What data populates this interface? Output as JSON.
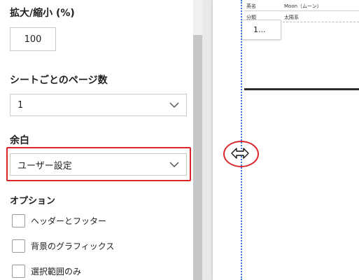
{
  "settings": {
    "scale": {
      "label": "拡大/縮小 (%)",
      "value": "100"
    },
    "pages_per_sheet": {
      "label": "シートごとのページ数",
      "value": "1"
    },
    "margins": {
      "label": "余白",
      "value": "ユーザー設定"
    },
    "options": {
      "label": "オプション",
      "items": [
        {
          "label": "ヘッダーとフッター",
          "checked": false
        },
        {
          "label": "背景のグラフィックス",
          "checked": false
        },
        {
          "label": "選択範囲のみ",
          "checked": false
        }
      ]
    }
  },
  "preview": {
    "rows": [
      {
        "key": "英名",
        "value": "Moon（ムーン）"
      },
      {
        "key": "分類",
        "value": "太陽系"
      }
    ],
    "tile_value": "1..."
  },
  "colors": {
    "highlight": "#d9262a",
    "margin_guide": "#3a78d4"
  },
  "icons": {
    "dropdown": "chevron-down-icon",
    "resize_cursor": "horizontal-resize-icon"
  }
}
